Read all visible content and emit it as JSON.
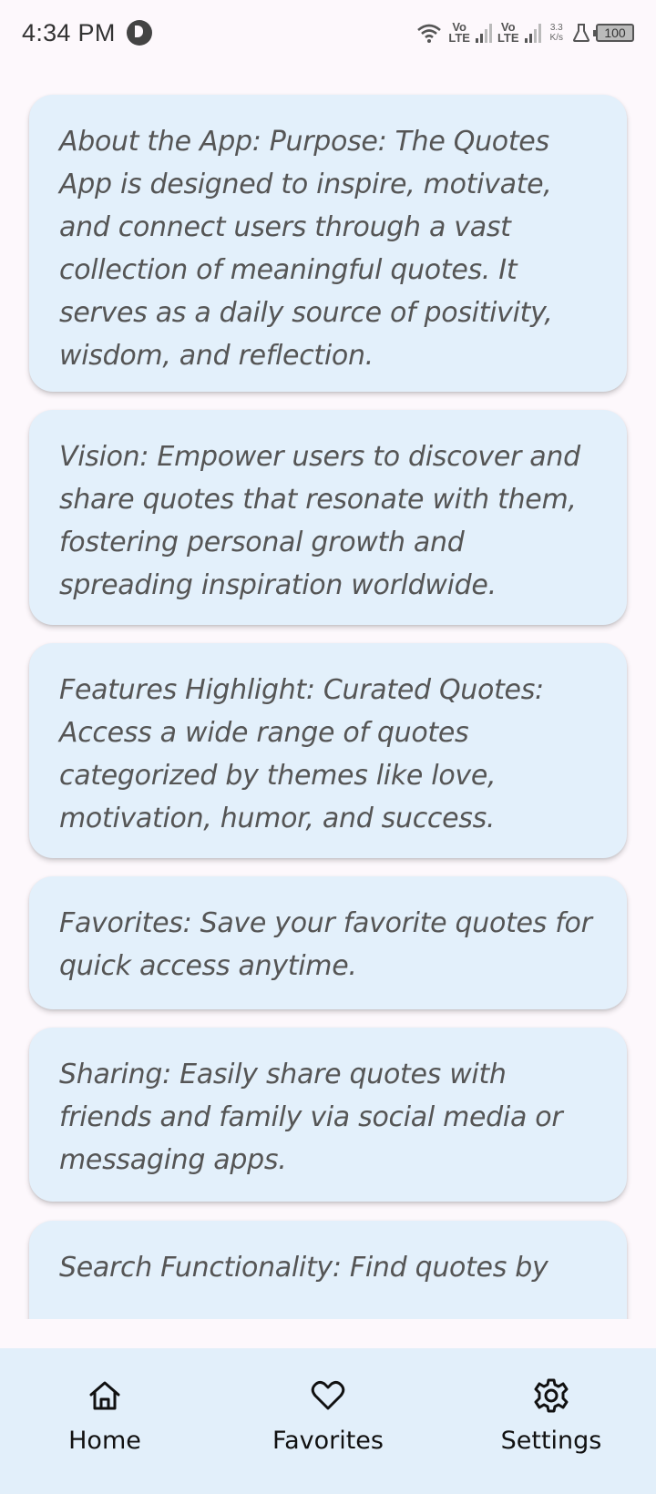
{
  "status_bar": {
    "time": "4:34 PM",
    "net1": "Vo\nLTE",
    "net2": "Vo\nLTE",
    "speed": "3.3\nK/s",
    "battery": "100"
  },
  "cards": [
    {
      "text": "About the App: Purpose: The Quotes App is designed to inspire, motivate, and connect users through a vast collection of meaningful quotes. It serves as a daily source of positivity, wisdom, and reflection."
    },
    {
      "text": "Vision: Empower users to discover and share quotes that resonate with them, fostering personal growth and spreading inspiration worldwide."
    },
    {
      "text": "Features Highlight: Curated Quotes: Access a wide range of quotes categorized by themes like love, motivation, humor, and success."
    },
    {
      "text": "Favorites: Save your favorite quotes for quick access anytime."
    },
    {
      "text": "Sharing: Easily share quotes with friends and family via social media or messaging apps."
    },
    {
      "text": "Search Functionality: Find quotes by"
    }
  ],
  "bottom_nav": {
    "items": [
      {
        "label": "Home",
        "icon": "home-icon"
      },
      {
        "label": "Favorites",
        "icon": "heart-icon"
      },
      {
        "label": "Settings",
        "icon": "gear-icon"
      }
    ]
  }
}
